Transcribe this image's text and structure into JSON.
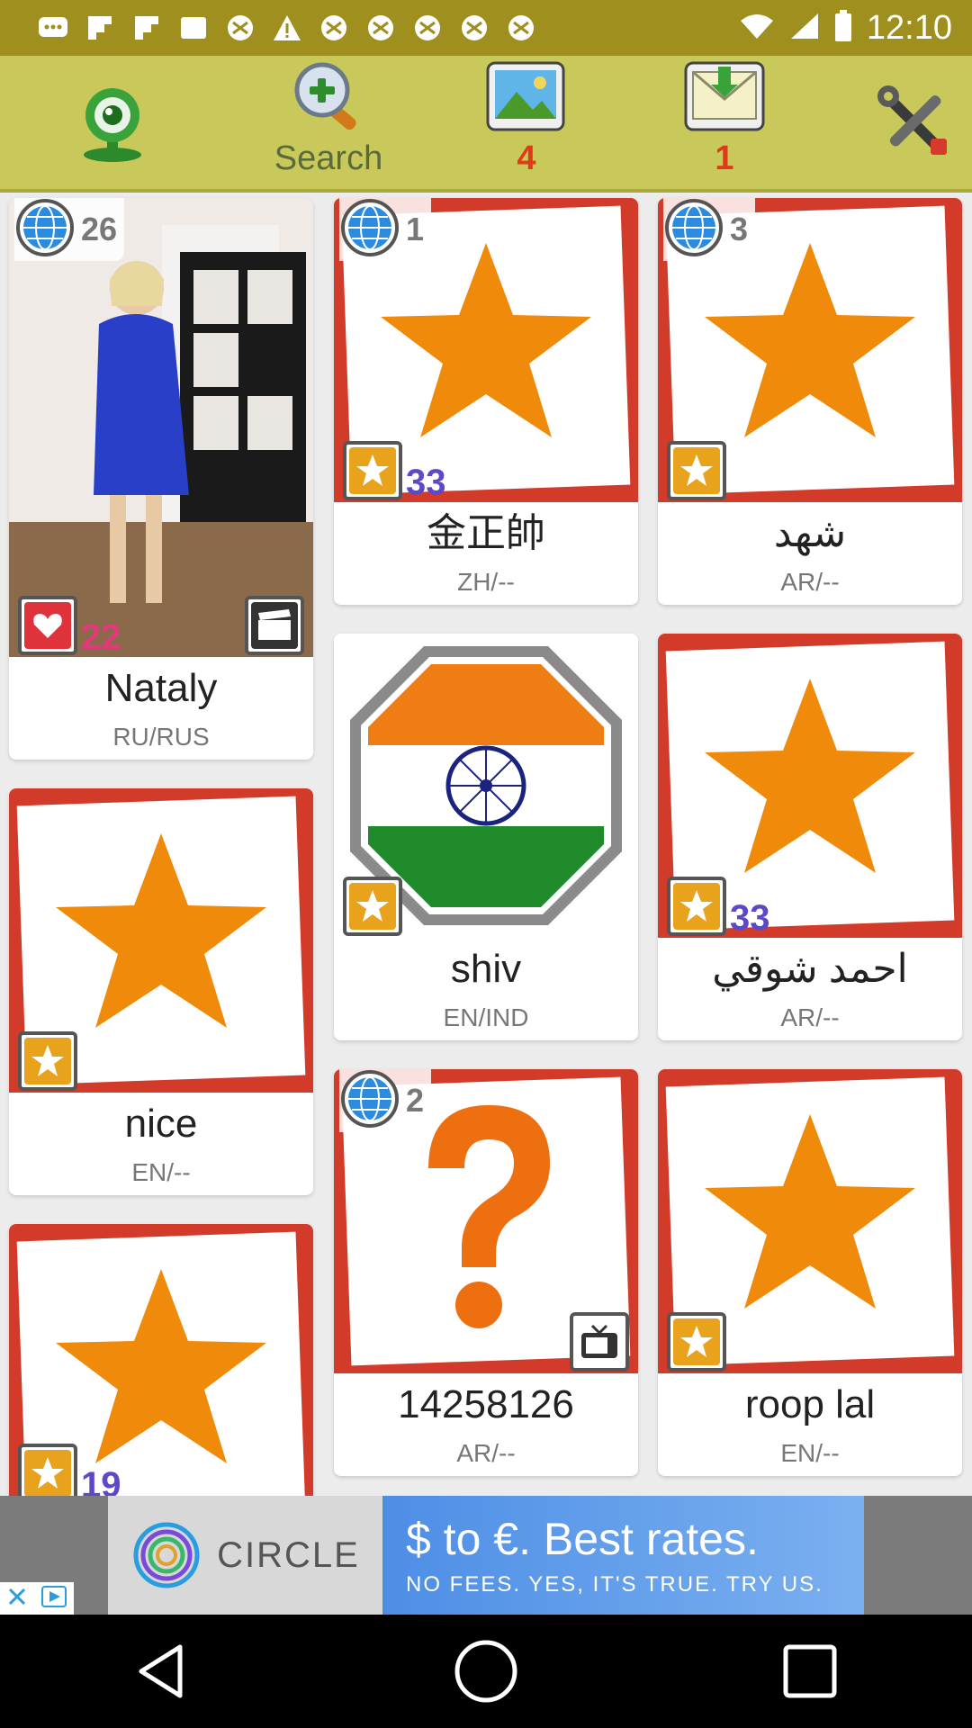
{
  "status_bar": {
    "time": "12:10",
    "icons": [
      "message-icon",
      "flipboard-icon",
      "flipboard-icon",
      "square-icon",
      "soccer-icon",
      "warning-icon",
      "soccer-icon",
      "soccer-icon",
      "soccer-icon",
      "soccer-icon",
      "soccer-icon",
      "soccer-icon",
      "soccer-icon"
    ],
    "right_icons": [
      "wifi-icon",
      "signal-icon",
      "battery-icon"
    ]
  },
  "toolbar": {
    "webcam": {
      "icon": "webcam-icon"
    },
    "search": {
      "icon": "search-icon",
      "label": "Search"
    },
    "photos": {
      "icon": "photos-icon",
      "count": "4"
    },
    "messages": {
      "icon": "mail-icon",
      "count": "1"
    },
    "settings": {
      "icon": "settings-tools-icon"
    }
  },
  "profiles": [
    {
      "name": "Nataly",
      "lang": "RU/RUS",
      "globe_count": "26",
      "heart_count": "22",
      "photo": true
    },
    {
      "name": "金正帥",
      "lang": "ZH/--",
      "globe_count": "1",
      "star_count": "33"
    },
    {
      "name": "شهد",
      "lang": "AR/--",
      "globe_count": "3",
      "star_count": ""
    },
    {
      "name": "shiv",
      "lang": "EN/IND",
      "flag": "India"
    },
    {
      "name": "احمد شوقي",
      "lang": "AR/--",
      "star_count": "33"
    },
    {
      "name": "nice",
      "lang": "EN/--",
      "star_count": ""
    },
    {
      "name": "14258126",
      "lang": "AR/--",
      "globe_count": "2"
    },
    {
      "name": "roop lal",
      "lang": "EN/--",
      "star_count": ""
    },
    {
      "name": "",
      "lang": "",
      "star_count": "19"
    }
  ],
  "ad": {
    "brand": "CIRCLE",
    "headline": "$ to €. Best rates.",
    "sub": "NO FEES. YES, IT'S TRUE. TRY US."
  },
  "colors": {
    "toolbar": "#c8c95a",
    "status_bar": "#9e8f1f",
    "star": "#ef8a0a",
    "frame": "#d23a2a",
    "count_red": "#e03a1a",
    "badge_purple": "#5b49c8"
  }
}
